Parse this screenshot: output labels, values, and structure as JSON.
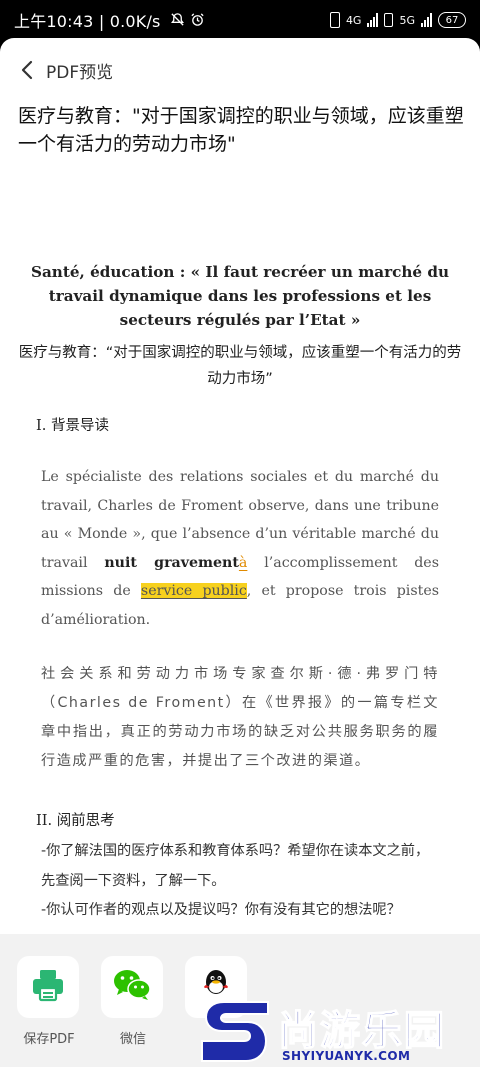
{
  "status_bar": {
    "time": "上午10:43",
    "speed": "0.0K/s",
    "network_1": "4G",
    "network_2": "5G",
    "battery": "67"
  },
  "app_bar": {
    "title": "PDF预览"
  },
  "document": {
    "title": "医疗与教育：\"对于国家调控的职业与领域，应该重塑一个有活力的劳动力市场\"",
    "fr_heading": "Santé, éducation : « Il faut recréer un marché du travail dynamique dans les professions et les secteurs régulés par l’Etat »",
    "zh_heading": "医疗与教育：“对于国家调控的职业与领域，应该重塑一个有活力的劳动力市场”",
    "section1": {
      "number": "I.",
      "title": "背景导读"
    },
    "fr_paragraph": {
      "part1": "Le spécialiste des relations sociales et du marché du travail, Charles de Froment observe, dans une tribune au « Monde », que l’absence d’un véritable marché du travail ",
      "bold": "nuit gravement",
      "highlight_a": "à",
      "part2": " l’accomplissement des missions de ",
      "highlight": "service public",
      "part3": ", et propose trois pistes d’amélioration."
    },
    "zh_paragraph": "社会关系和劳动力市场专家查尔斯·德·弗罗门特（Charles de Froment）在《世界报》的一篇专栏文章中指出，真正的劳动力市场的缺乏对公共服务职务的履行造成严重的危害，并提出了三个改进的渠道。",
    "section2": {
      "number": "II.",
      "title": "阅前思考"
    },
    "questions": [
      "-你了解法国的医疗体系和教育体系吗？希望你在读本文之前，先查阅一下资料，了解一下。",
      "-你认可作者的观点以及提议吗？你有没有其它的想法呢？"
    ]
  },
  "share": {
    "items": [
      {
        "label": "保存PDF",
        "icon": "printer-icon"
      },
      {
        "label": "微信",
        "icon": "wechat-icon"
      },
      {
        "label": "",
        "icon": "qq-icon"
      }
    ]
  },
  "watermark": {
    "brand_cn": "尚游乐园",
    "brand_en": "SHYIYUANYK.COM"
  },
  "colors": {
    "highlight": "#f7d11e",
    "save_icon": "#2bb673",
    "wechat": "#2dc100",
    "brand": "#1f2ba8"
  }
}
